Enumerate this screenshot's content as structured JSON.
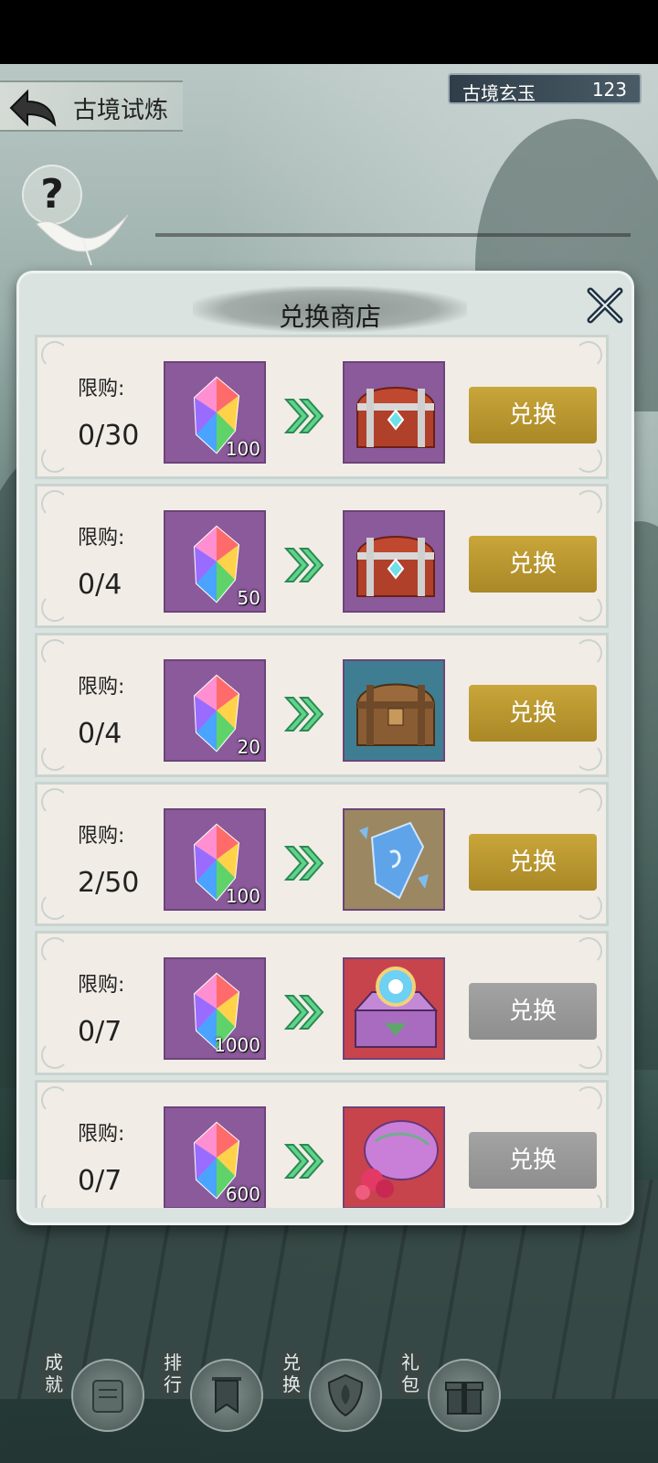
{
  "header": {
    "title": "古境试炼",
    "currency_name": "古境玄玉",
    "currency_value": "123",
    "help_symbol": "?"
  },
  "modal": {
    "title": "兑换商店",
    "items": [
      {
        "limit_label": "限购:",
        "limit": "0/30",
        "cost": "100",
        "reward": "red-silver-chest",
        "button": "兑换",
        "enabled": true
      },
      {
        "limit_label": "限购:",
        "limit": "0/4",
        "cost": "50",
        "reward": "red-silver-chest",
        "button": "兑换",
        "enabled": true
      },
      {
        "limit_label": "限购:",
        "limit": "0/4",
        "cost": "20",
        "reward": "wooden-chest",
        "button": "兑换",
        "enabled": true
      },
      {
        "limit_label": "限购:",
        "limit": "2/50",
        "cost": "100",
        "reward": "blue-crystal",
        "button": "兑换",
        "enabled": true
      },
      {
        "limit_label": "限购:",
        "limit": "0/7",
        "cost": "1000",
        "reward": "purple-magic-chest",
        "button": "兑换",
        "enabled": false
      },
      {
        "limit_label": "限购:",
        "limit": "0/7",
        "cost": "600",
        "reward": "pink-flower-bag",
        "button": "兑换",
        "enabled": false
      }
    ]
  },
  "bottom_nav": [
    {
      "label": "成就",
      "icon": "scroll-icon"
    },
    {
      "label": "排行",
      "icon": "banner-icon"
    },
    {
      "label": "兑换",
      "icon": "shield-icon"
    },
    {
      "label": "礼包",
      "icon": "gift-icon"
    }
  ],
  "colors": {
    "button_enabled": "#b8962f",
    "button_disabled": "#9a9a9a",
    "cost_box": "#8b5a9b"
  }
}
